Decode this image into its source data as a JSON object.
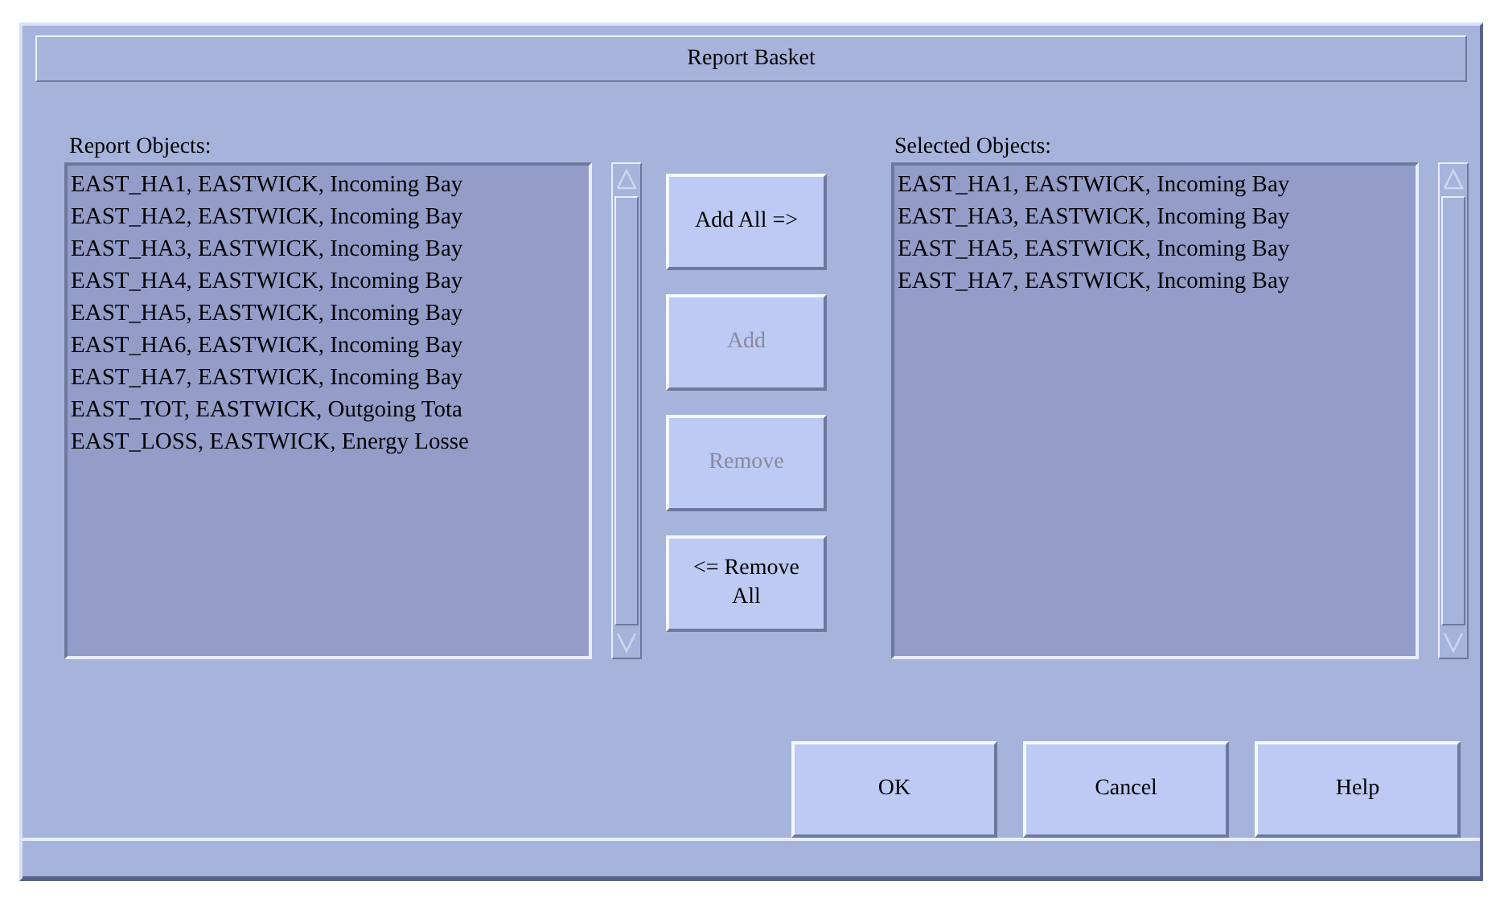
{
  "window": {
    "title": "Report Basket"
  },
  "report_objects": {
    "label": "Report Objects:",
    "items": [
      "EAST_HA1, EASTWICK, Incoming Bay",
      "EAST_HA2, EASTWICK, Incoming Bay",
      "EAST_HA3, EASTWICK, Incoming Bay",
      "EAST_HA4, EASTWICK, Incoming Bay",
      "EAST_HA5, EASTWICK, Incoming Bay",
      "EAST_HA6, EASTWICK, Incoming Bay",
      "EAST_HA7, EASTWICK, Incoming Bay",
      "EAST_TOT, EASTWICK, Outgoing Tota",
      "EAST_LOSS, EASTWICK, Energy Losse"
    ]
  },
  "transfer_buttons": [
    {
      "label": "Add All =>",
      "disabled": false
    },
    {
      "label": "Add",
      "disabled": true
    },
    {
      "label": "Remove",
      "disabled": true
    },
    {
      "label": "<= Remove All",
      "disabled": false
    }
  ],
  "selected_objects": {
    "label": "Selected Objects:",
    "items": [
      "EAST_HA1, EASTWICK, Incoming Bay",
      "EAST_HA3, EASTWICK, Incoming Bay",
      "EAST_HA5, EASTWICK, Incoming Bay",
      "EAST_HA7, EASTWICK, Incoming Bay"
    ]
  },
  "dialog_buttons": [
    {
      "label": "OK"
    },
    {
      "label": "Cancel"
    },
    {
      "label": "Help"
    }
  ]
}
